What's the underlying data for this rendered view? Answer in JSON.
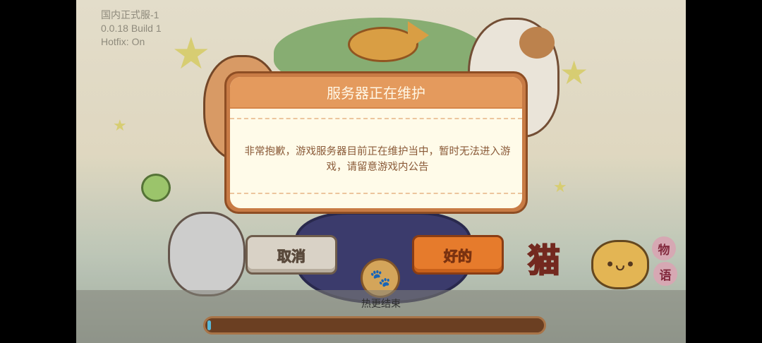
{
  "version_info": {
    "server": "国内正式服-1",
    "build": "0.0.18 Build 1",
    "hotfix": "Hotfix: On"
  },
  "dialog": {
    "title": "服务器正在维护",
    "message": "非常抱歉，游戏服务器目前正在维护当中，暂时无法进入游戏，请留意游戏内公告"
  },
  "buttons": {
    "cancel": "取消",
    "ok": "好的"
  },
  "progress": {
    "label": "热更结束",
    "fraction": 0.01
  },
  "logo": {
    "title": "猫",
    "tag_1": "物",
    "tag_2": "语"
  },
  "icons": {
    "coin": "paw-coin-icon",
    "fish": "fish-icon",
    "stars": "star-icon"
  },
  "colors": {
    "dialog_border": "#c87b45",
    "dialog_header": "#e49a5d",
    "ok_button": "#e67b2c",
    "cancel_button": "#d9d2c6",
    "progress_fill": "#5ab7d6"
  }
}
